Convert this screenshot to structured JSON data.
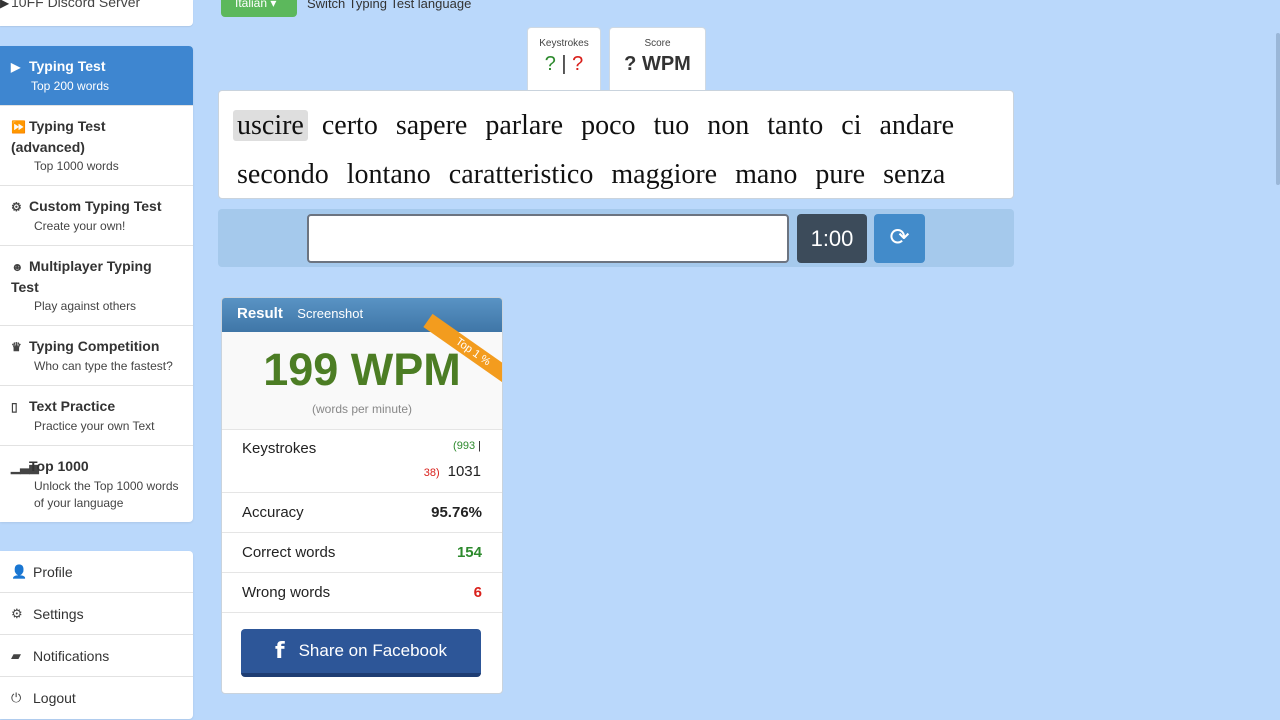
{
  "sidebar": {
    "top_item": "10FF Discord Server",
    "items": [
      {
        "title": "Typing Test",
        "sub": "Top 200 words",
        "icon": "play-icon"
      },
      {
        "title": "Typing Test (advanced)",
        "sub": "Top 1000 words",
        "icon": "fast-forward-icon"
      },
      {
        "title": "Custom Typing Test",
        "sub": "Create your own!",
        "icon": "gears-icon"
      },
      {
        "title": "Multiplayer Typing Test",
        "sub": "Play against others",
        "icon": "users-icon"
      },
      {
        "title": "Typing Competition",
        "sub": "Who can type the fastest?",
        "icon": "trophy-icon"
      },
      {
        "title": "Text Practice",
        "sub": "Practice your own Text",
        "icon": "file-icon"
      },
      {
        "title": "Top 1000",
        "sub": "Unlock the Top 1000 words of your language",
        "icon": "signal-icon"
      }
    ],
    "account": [
      {
        "label": "Profile",
        "icon": "user-icon"
      },
      {
        "label": "Settings",
        "icon": "gear-icon"
      },
      {
        "label": "Notifications",
        "icon": "comment-icon"
      },
      {
        "label": "Logout",
        "icon": "logout-icon"
      }
    ]
  },
  "lang": {
    "button": "Italian",
    "hint": "Switch Typing Test language"
  },
  "stats": {
    "keystrokes_label": "Keystrokes",
    "keystrokes_correct": "?",
    "keystrokes_sep": "|",
    "keystrokes_wrong": "?",
    "score_label": "Score",
    "score_value": "? WPM"
  },
  "words": [
    "uscire",
    "certo",
    "sapere",
    "parlare",
    "poco",
    "tuo",
    "non",
    "tanto",
    "ci",
    "andare",
    "secondo",
    "lontano",
    "caratteristico",
    "maggiore",
    "mano",
    "pure",
    "senza"
  ],
  "timer": "1:00",
  "result": {
    "title": "Result",
    "screenshot": "Screenshot",
    "ribbon": "Top 1 %",
    "wpm": "199 WPM",
    "wpm_sub": "(words per minute)",
    "keystrokes_label": "Keystrokes",
    "ks_correct": "(993",
    "ks_sep": " |",
    "ks_wrong": "38)",
    "ks_total": "1031",
    "accuracy_label": "Accuracy",
    "accuracy": "95.76%",
    "correct_label": "Correct words",
    "correct": "154",
    "wrong_label": "Wrong words",
    "wrong": "6",
    "share": "Share on Facebook"
  },
  "colors": {
    "accent": "#3e86d0",
    "green": "#2d8a2d",
    "red": "#d9201b",
    "background": "#bad8fb"
  }
}
